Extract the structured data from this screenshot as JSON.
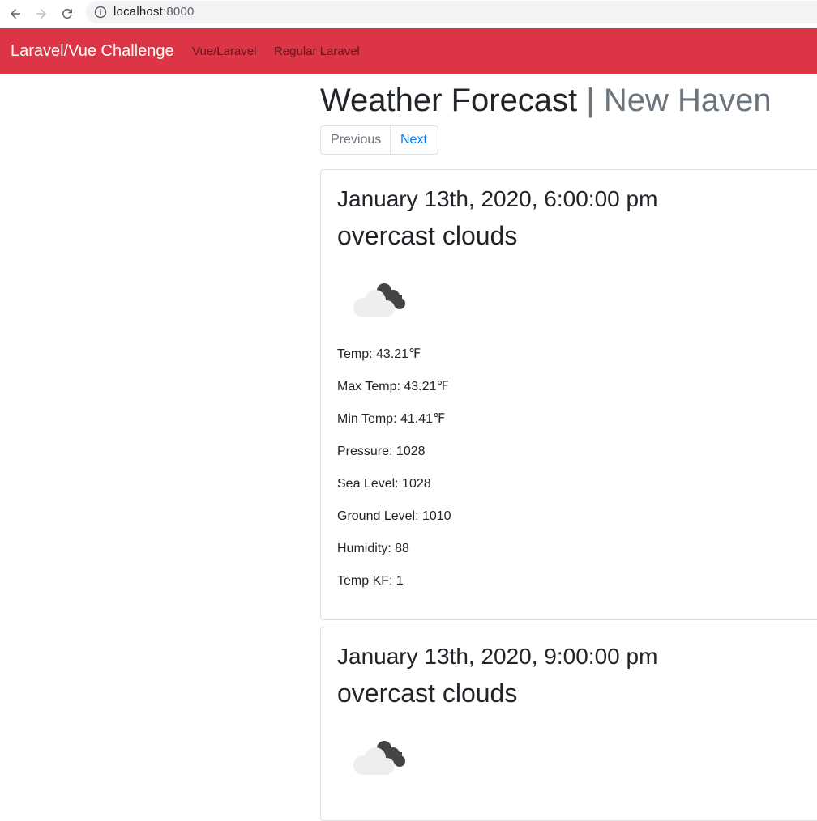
{
  "browser": {
    "url_host": "localhost",
    "url_port": ":8000"
  },
  "navbar": {
    "brand": "Laravel/Vue Challenge",
    "links": [
      "Vue/Laravel",
      "Regular Laravel"
    ]
  },
  "page": {
    "title": "Weather Forecast",
    "title_separator": "|",
    "city": "New Haven"
  },
  "pagination": {
    "previous": "Previous",
    "next": "Next"
  },
  "forecasts": [
    {
      "datetime": "January 13th, 2020, 6:00:00 pm",
      "description": "overcast clouds",
      "icon": "overcast-clouds-icon",
      "stats": [
        "Temp: 43.21℉",
        "Max Temp: 43.21℉",
        "Min Temp: 41.41℉",
        "Pressure: 1028",
        "Sea Level: 1028",
        "Ground Level: 1010",
        "Humidity: 88",
        "Temp KF: 1"
      ]
    },
    {
      "datetime": "January 13th, 2020, 9:00:00 pm",
      "description": "overcast clouds",
      "icon": "overcast-clouds-icon"
    }
  ],
  "colors": {
    "navbar": "#dc3545",
    "link": "#007bff",
    "muted": "#6c757d"
  }
}
